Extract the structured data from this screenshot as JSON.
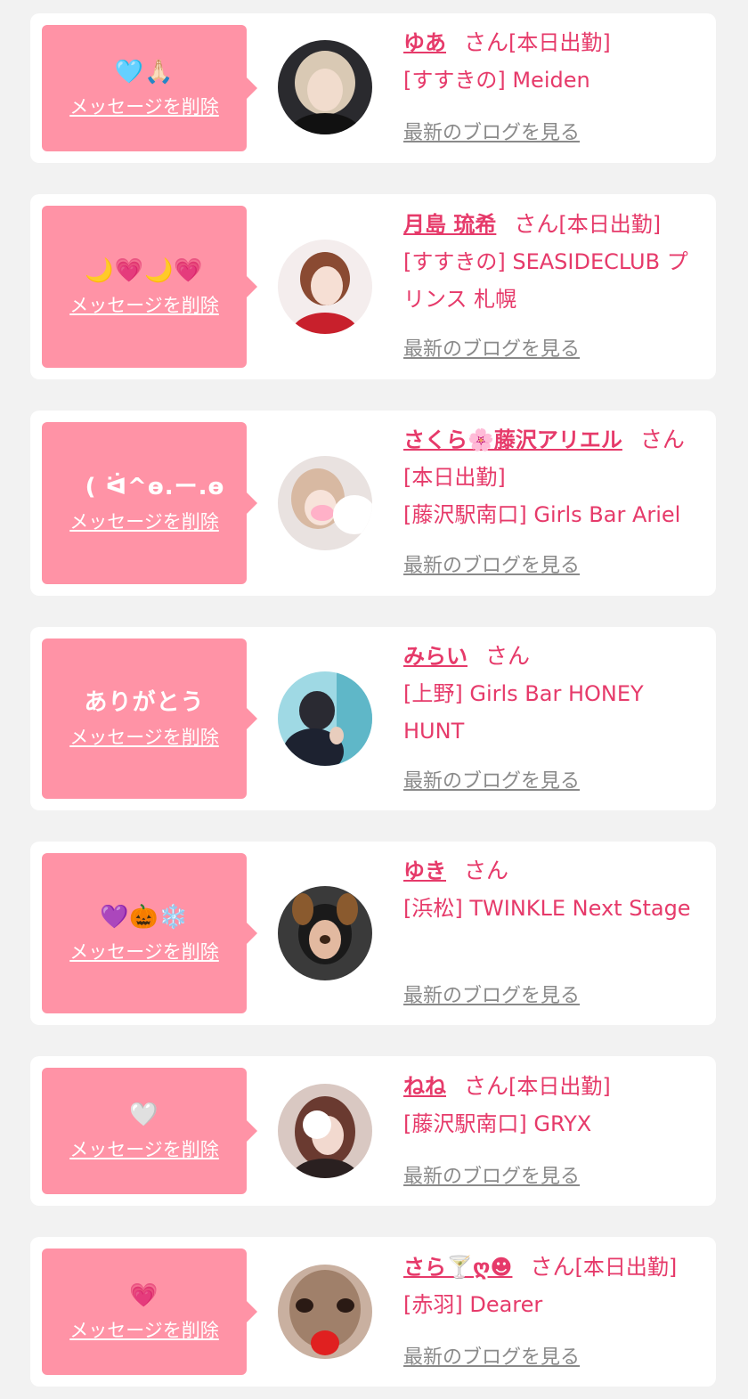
{
  "common": {
    "delete_label": "メッセージを削除",
    "blog_label": "最新のブログを見る",
    "san_label": "さん"
  },
  "colors": {
    "page_bg": "#f2f2f2",
    "card_bg": "#ffffff",
    "bubble_bg": "#ff93a6",
    "name_text": "#e63a6a",
    "link_gray": "#8a8a8a"
  },
  "items": [
    {
      "message": "🩵🙏🏻",
      "name": "ゆあ",
      "status": "[本日出勤]",
      "shop": "[すすきの] Meiden"
    },
    {
      "message": "🌙💗🌙💗",
      "name": "月島 琉希",
      "status": "[本日出勤]",
      "shop": "[すすきの] SEASIDECLUB プリンス 札幌"
    },
    {
      "message": "ㅤ( ᐛ^ѳ.ー.ѳ",
      "name": "さくら🌸藤沢アリエル",
      "status": "[本日出勤]",
      "shop": "[藤沢駅南口] Girls Bar Ariel"
    },
    {
      "message": "ありがとう",
      "name": "みらい",
      "status": "",
      "shop": "[上野] Girls Bar HONEY HUNT"
    },
    {
      "message": "💜🎃❄️",
      "name": "ゆき",
      "status": "",
      "shop": "[浜松] TWINKLE Next Stage"
    },
    {
      "message": "🤍",
      "name": "ねね",
      "status": "[本日出勤]",
      "shop": "[藤沢駅南口] GRYX"
    },
    {
      "message": "💗",
      "name": "さら🍸ღ☻",
      "status": "[本日出勤]",
      "shop": "[赤羽] Dearer"
    }
  ]
}
